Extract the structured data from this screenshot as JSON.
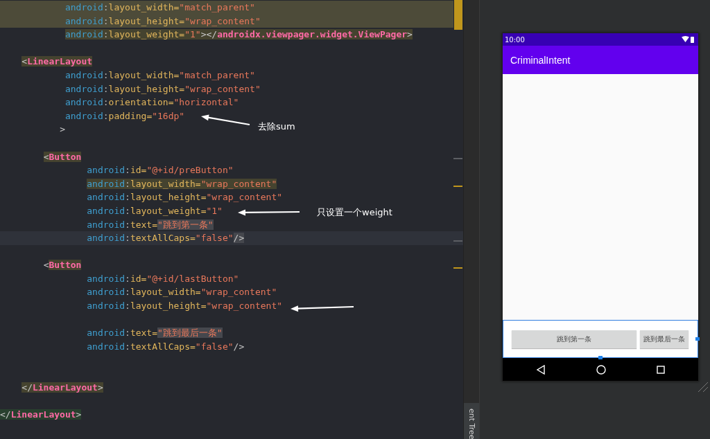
{
  "editor": {
    "lines": [
      {
        "kind": "attr",
        "highlighted": true,
        "selected": false,
        "tokens": [
          {
            "kind": "ns",
            "s": "android",
            "marked": false
          },
          {
            "kind": "colon",
            "s": ":",
            "marked": false
          },
          {
            "kind": "attr",
            "s": "layout_width",
            "marked": false
          },
          {
            "kind": "eq",
            "s": "=",
            "marked": false
          },
          {
            "kind": "value",
            "s": "\"match_parent\"",
            "marked": false
          }
        ]
      },
      {
        "kind": "attr",
        "highlighted": true,
        "selected": false,
        "tokens": [
          {
            "kind": "ns",
            "s": "android",
            "marked": false
          },
          {
            "kind": "colon",
            "s": ":",
            "marked": false
          },
          {
            "kind": "attr",
            "s": "layout_height",
            "marked": false
          },
          {
            "kind": "eq",
            "s": "=",
            "marked": false
          },
          {
            "kind": "value",
            "s": "\"wrap_content\"",
            "marked": false
          }
        ]
      },
      {
        "kind": "attr",
        "highlighted": false,
        "selected": false,
        "tokens": [
          {
            "kind": "ns",
            "s": "android",
            "marked": true
          },
          {
            "kind": "colon",
            "s": ":",
            "marked": true
          },
          {
            "kind": "attr",
            "s": "layout_weight",
            "marked": true
          },
          {
            "kind": "eq",
            "s": "=",
            "marked": true
          },
          {
            "kind": "value",
            "s": "\"1\"",
            "marked": true
          },
          {
            "kind": "punct",
            "s": "></",
            "marked": true
          },
          {
            "kind": "tag",
            "s": "androidx.viewpager.widget.ViewPager",
            "marked": true
          },
          {
            "kind": "punct",
            "s": ">",
            "marked": true
          }
        ]
      },
      {
        "kind": "blank",
        "highlighted": false,
        "selected": false
      },
      {
        "kind": "tag",
        "highlighted": false,
        "selected": false,
        "tokens": [
          {
            "kind": "punct",
            "s": "<",
            "marked": true
          },
          {
            "kind": "tag",
            "s": "LinearLayout",
            "marked": true
          }
        ]
      },
      {
        "kind": "attr",
        "highlighted": false,
        "selected": false,
        "tokens": [
          {
            "kind": "ns",
            "s": "android",
            "marked": false
          },
          {
            "kind": "colon",
            "s": ":",
            "marked": false
          },
          {
            "kind": "attr",
            "s": "layout_width",
            "marked": false
          },
          {
            "kind": "eq",
            "s": "=",
            "marked": false
          },
          {
            "kind": "value",
            "s": "\"match_parent\"",
            "marked": false
          }
        ]
      },
      {
        "kind": "attr",
        "highlighted": false,
        "selected": false,
        "tokens": [
          {
            "kind": "ns",
            "s": "android",
            "marked": false
          },
          {
            "kind": "colon",
            "s": ":",
            "marked": false
          },
          {
            "kind": "attr",
            "s": "layout_height",
            "marked": false
          },
          {
            "kind": "eq",
            "s": "=",
            "marked": false
          },
          {
            "kind": "value",
            "s": "\"wrap_content\"",
            "marked": false
          }
        ]
      },
      {
        "kind": "attr",
        "highlighted": false,
        "selected": false,
        "tokens": [
          {
            "kind": "ns",
            "s": "android",
            "marked": false
          },
          {
            "kind": "colon",
            "s": ":",
            "marked": false
          },
          {
            "kind": "attr",
            "s": "orientation",
            "marked": false
          },
          {
            "kind": "eq",
            "s": "=",
            "marked": false
          },
          {
            "kind": "value",
            "s": "\"horizontal\"",
            "marked": false
          }
        ]
      },
      {
        "kind": "attr",
        "highlighted": false,
        "selected": false,
        "tokens": [
          {
            "kind": "ns",
            "s": "android",
            "marked": false
          },
          {
            "kind": "colon",
            "s": ":",
            "marked": false
          },
          {
            "kind": "attr",
            "s": "padding",
            "marked": false
          },
          {
            "kind": "eq",
            "s": "=",
            "marked": false
          },
          {
            "kind": "value",
            "s": "\"16dp\"",
            "marked": false
          }
        ]
      },
      {
        "kind": "bracket",
        "highlighted": false,
        "selected": false,
        "tokens": [
          {
            "kind": "punct",
            "s": ">",
            "marked": false
          }
        ]
      },
      {
        "kind": "blank",
        "highlighted": false,
        "selected": false
      },
      {
        "kind": "child-tag",
        "highlighted": false,
        "selected": false,
        "tokens": [
          {
            "kind": "punct",
            "s": "<",
            "marked": true
          },
          {
            "kind": "tag",
            "s": "Button",
            "marked": true
          }
        ]
      },
      {
        "kind": "child-attr",
        "highlighted": false,
        "selected": false,
        "tokens": [
          {
            "kind": "ns",
            "s": "android",
            "marked": false
          },
          {
            "kind": "colon",
            "s": ":",
            "marked": false
          },
          {
            "kind": "attr",
            "s": "id",
            "marked": false
          },
          {
            "kind": "eq",
            "s": "=",
            "marked": false
          },
          {
            "kind": "value",
            "s": "\"@+id/preButton\"",
            "marked": false
          }
        ]
      },
      {
        "kind": "child-attr",
        "highlighted": false,
        "selected": false,
        "tokens": [
          {
            "kind": "ns",
            "s": "android",
            "marked": true
          },
          {
            "kind": "colon",
            "s": ":",
            "marked": true
          },
          {
            "kind": "attr",
            "s": "layout_width",
            "marked": true
          },
          {
            "kind": "eq",
            "s": "=",
            "marked": true
          },
          {
            "kind": "value",
            "s": "\"wrap_content\"",
            "marked": true
          }
        ]
      },
      {
        "kind": "child-attr",
        "highlighted": false,
        "selected": false,
        "tokens": [
          {
            "kind": "ns",
            "s": "android",
            "marked": false
          },
          {
            "kind": "colon",
            "s": ":",
            "marked": false
          },
          {
            "kind": "attr",
            "s": "layout_height",
            "marked": false
          },
          {
            "kind": "eq",
            "s": "=",
            "marked": false
          },
          {
            "kind": "value",
            "s": "\"wrap_content\"",
            "marked": false
          }
        ]
      },
      {
        "kind": "child-attr",
        "highlighted": false,
        "selected": false,
        "tokens": [
          {
            "kind": "ns",
            "s": "android",
            "marked": false
          },
          {
            "kind": "colon",
            "s": ":",
            "marked": false
          },
          {
            "kind": "attr",
            "s": "layout_weight",
            "marked": false
          },
          {
            "kind": "eq",
            "s": "=",
            "marked": false
          },
          {
            "kind": "value",
            "s": "\"1\"",
            "marked": false
          }
        ]
      },
      {
        "kind": "child-attr",
        "highlighted": false,
        "selected": false,
        "tokens": [
          {
            "kind": "ns",
            "s": "android",
            "marked": false
          },
          {
            "kind": "colon",
            "s": ":",
            "marked": false
          },
          {
            "kind": "attr",
            "s": "text",
            "marked": false
          },
          {
            "kind": "eq",
            "s": "=",
            "marked": false
          },
          {
            "kind": "string",
            "s": "\"跳到第一条\"",
            "marked": true
          }
        ]
      },
      {
        "kind": "child-attr",
        "highlighted": false,
        "selected": true,
        "tokens": [
          {
            "kind": "ns",
            "s": "android",
            "marked": false
          },
          {
            "kind": "colon",
            "s": ":",
            "marked": false
          },
          {
            "kind": "attr",
            "s": "textAllCaps",
            "marked": false
          },
          {
            "kind": "eq",
            "s": "=",
            "marked": false
          },
          {
            "kind": "value",
            "s": "\"false\"",
            "marked": false
          },
          {
            "kind": "self-close",
            "s": "/>",
            "marked": true
          }
        ]
      },
      {
        "kind": "blank",
        "highlighted": false,
        "selected": false
      },
      {
        "kind": "child-tag",
        "highlighted": false,
        "selected": false,
        "tokens": [
          {
            "kind": "punct",
            "s": "<",
            "marked": false
          },
          {
            "kind": "tag",
            "s": "Button",
            "marked": true
          }
        ]
      },
      {
        "kind": "child-attr",
        "highlighted": false,
        "selected": false,
        "tokens": [
          {
            "kind": "ns",
            "s": "android",
            "marked": false
          },
          {
            "kind": "colon",
            "s": ":",
            "marked": false
          },
          {
            "kind": "attr",
            "s": "id",
            "marked": false
          },
          {
            "kind": "eq",
            "s": "=",
            "marked": false
          },
          {
            "kind": "value",
            "s": "\"@+id/lastButton\"",
            "marked": false
          }
        ]
      },
      {
        "kind": "child-attr",
        "highlighted": false,
        "selected": false,
        "tokens": [
          {
            "kind": "ns",
            "s": "android",
            "marked": false
          },
          {
            "kind": "colon",
            "s": ":",
            "marked": false
          },
          {
            "kind": "attr",
            "s": "layout_width",
            "marked": false
          },
          {
            "kind": "eq",
            "s": "=",
            "marked": false
          },
          {
            "kind": "value",
            "s": "\"wrap_content\"",
            "marked": false
          }
        ]
      },
      {
        "kind": "child-attr",
        "highlighted": false,
        "selected": false,
        "tokens": [
          {
            "kind": "ns",
            "s": "android",
            "marked": false
          },
          {
            "kind": "colon",
            "s": ":",
            "marked": false
          },
          {
            "kind": "attr",
            "s": "layout_height",
            "marked": false
          },
          {
            "kind": "eq",
            "s": "=",
            "marked": false
          },
          {
            "kind": "value",
            "s": "\"wrap_content\"",
            "marked": false
          }
        ]
      },
      {
        "kind": "blank",
        "highlighted": false,
        "selected": false
      },
      {
        "kind": "child-attr",
        "highlighted": false,
        "selected": false,
        "tokens": [
          {
            "kind": "ns",
            "s": "android",
            "marked": false
          },
          {
            "kind": "colon",
            "s": ":",
            "marked": false
          },
          {
            "kind": "attr",
            "s": "text",
            "marked": false
          },
          {
            "kind": "eq",
            "s": "=",
            "marked": false
          },
          {
            "kind": "string",
            "s": "\"跳到最后一条\"",
            "marked": true
          }
        ]
      },
      {
        "kind": "child-attr",
        "highlighted": false,
        "selected": false,
        "tokens": [
          {
            "kind": "ns",
            "s": "android",
            "marked": false
          },
          {
            "kind": "colon",
            "s": ":",
            "marked": false
          },
          {
            "kind": "attr",
            "s": "textAllCaps",
            "marked": false
          },
          {
            "kind": "eq",
            "s": "=",
            "marked": false
          },
          {
            "kind": "value",
            "s": "\"false\"",
            "marked": false
          },
          {
            "kind": "self-close",
            "s": "/>",
            "marked": false
          }
        ]
      },
      {
        "kind": "blank",
        "highlighted": false,
        "selected": false
      },
      {
        "kind": "blank",
        "highlighted": false,
        "selected": false
      },
      {
        "kind": "tag",
        "highlighted": false,
        "selected": false,
        "tokens": [
          {
            "kind": "punct",
            "s": "</",
            "marked": true
          },
          {
            "kind": "tag",
            "s": "LinearLayout",
            "marked": true
          },
          {
            "kind": "punct",
            "s": ">",
            "marked": true
          }
        ]
      },
      {
        "kind": "blank",
        "highlighted": false,
        "selected": false
      },
      {
        "kind": "outer-tag",
        "highlighted": false,
        "selected": false,
        "tokens": [
          {
            "kind": "punct",
            "s": "</",
            "marked": true
          },
          {
            "kind": "tag",
            "s": "LinearLayout",
            "marked": true
          },
          {
            "kind": "punct",
            "s": ">",
            "marked": true
          }
        ]
      }
    ],
    "annotations": [
      {
        "kind": "noted-arrow",
        "note": "去除sum"
      },
      {
        "kind": "noted-arrow",
        "note": "只设置一个weight"
      },
      {
        "kind": "arrow"
      }
    ]
  },
  "side_tab": {
    "label": "ent Tree"
  },
  "preview": {
    "status_time": "10:00",
    "app_title": "CriminalIntent",
    "layout_selected": true,
    "buttons": [
      {
        "label": "跳到第一条"
      },
      {
        "label": "跳到最后一条"
      }
    ]
  }
}
